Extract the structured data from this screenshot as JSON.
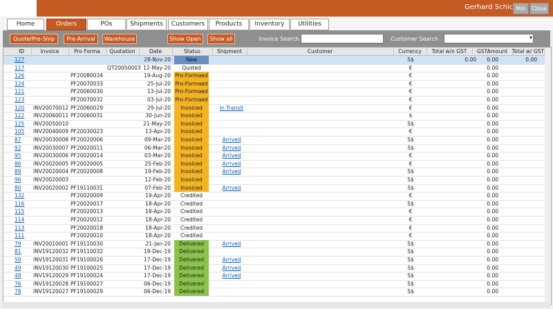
{
  "header": {
    "user_name": "Gerhard Schick",
    "min_label": "Min",
    "close_label": "Close"
  },
  "tabs": [
    "Home",
    "Orders",
    "POs",
    "Shipments",
    "Customers",
    "Products",
    "Inventory",
    "Utilities"
  ],
  "active_tab": "Orders",
  "filters": {
    "buttons": [
      "Quote/Pre-Ship",
      "Pre-Arrival",
      "Warehouse"
    ],
    "show_open": "Show Open",
    "show_all": "Show all",
    "invoice_search_label": "Invoice Search",
    "customer_search_label": "Customer Search"
  },
  "columns": [
    "ID",
    "Invoice",
    "Pro Forma",
    "Quotation",
    "Date",
    "Status",
    "Shipment",
    "Customer",
    "Currency",
    "Total w/o GST",
    "GSTAmount",
    "Total w/ GST"
  ],
  "rows": [
    {
      "id": "127",
      "inv": "",
      "pf": "",
      "q": "",
      "date": "28-Nov-20",
      "status": "New",
      "ship": "",
      "cur": "S$",
      "tot": "0.00",
      "gst": "0.00",
      "tgst": "0.00"
    },
    {
      "id": "117",
      "inv": "",
      "pf": "",
      "q": "QT20050003",
      "date": "12-May-20",
      "status": "Quoted",
      "ship": "",
      "cur": "€",
      "tot": "",
      "gst": "0.00",
      "tgst": ""
    },
    {
      "id": "126",
      "inv": "",
      "pf": "PF20080034",
      "q": "",
      "date": "19-Aug-20",
      "status": "Pro-Formaed",
      "ship": "",
      "cur": "€",
      "tot": "",
      "gst": "0.00",
      "tgst": ""
    },
    {
      "id": "124",
      "inv": "",
      "pf": "PF20070033",
      "q": "",
      "date": "25-Jul-20",
      "status": "Pro-Formaed",
      "ship": "",
      "cur": "€",
      "tot": "",
      "gst": "0.00",
      "tgst": ""
    },
    {
      "id": "121",
      "inv": "",
      "pf": "PF20060030",
      "q": "",
      "date": "13-Jul-20",
      "status": "Pro-Formaed",
      "ship": "",
      "cur": "€",
      "tot": "",
      "gst": "0.00",
      "tgst": ""
    },
    {
      "id": "123",
      "inv": "",
      "pf": "PF20070032",
      "q": "",
      "date": "03-Jul-20",
      "status": "Pro-Formaed",
      "ship": "",
      "cur": "€",
      "tot": "",
      "gst": "0.00",
      "tgst": ""
    },
    {
      "id": "120",
      "inv": "INV20070012",
      "pf": "PF20060029",
      "q": "",
      "date": "29-Jul-20",
      "status": "Invoiced",
      "ship": "In Transit",
      "cur": "€",
      "tot": "",
      "gst": "0.00",
      "tgst": ""
    },
    {
      "id": "122",
      "inv": "INV20060011",
      "pf": "PF20060031",
      "q": "",
      "date": "30-Jun-20",
      "status": "Invoiced",
      "ship": "",
      "cur": "$",
      "tot": "",
      "gst": "0.00",
      "tgst": ""
    },
    {
      "id": "125",
      "inv": "INV20050010",
      "pf": "",
      "q": "",
      "date": "21-May-20",
      "status": "Invoiced",
      "ship": "",
      "cur": "S$",
      "tot": "",
      "gst": "0.00",
      "tgst": ""
    },
    {
      "id": "105",
      "inv": "INV20040009",
      "pf": "PF20030023",
      "q": "",
      "date": "13-Apr-20",
      "status": "Invoiced",
      "ship": "",
      "cur": "€",
      "tot": "",
      "gst": "0.00",
      "tgst": ""
    },
    {
      "id": "87",
      "inv": "INV20030008",
      "pf": "PF20020006",
      "q": "",
      "date": "09-Mar-20",
      "status": "Invoiced",
      "ship": "Arrived",
      "cur": "S$",
      "tot": "",
      "gst": "0.00",
      "tgst": ""
    },
    {
      "id": "92",
      "inv": "INV20030007",
      "pf": "PF20020011",
      "q": "",
      "date": "06-Mar-20",
      "status": "Invoiced",
      "ship": "Arrived",
      "cur": "S$",
      "tot": "",
      "gst": "0.00",
      "tgst": ""
    },
    {
      "id": "95",
      "inv": "INV20030006",
      "pf": "PF20020014",
      "q": "",
      "date": "03-Mar-20",
      "status": "Invoiced",
      "ship": "Arrived",
      "cur": "€",
      "tot": "",
      "gst": "0.00",
      "tgst": ""
    },
    {
      "id": "86",
      "inv": "INV20020005",
      "pf": "PF20020005",
      "q": "",
      "date": "25-Feb-20",
      "status": "Invoiced",
      "ship": "Arrived",
      "cur": "€",
      "tot": "",
      "gst": "0.00",
      "tgst": ""
    },
    {
      "id": "89",
      "inv": "INV20020004",
      "pf": "PF20020008",
      "q": "",
      "date": "19-Feb-20",
      "status": "Invoiced",
      "ship": "Arrived",
      "cur": "S$",
      "tot": "",
      "gst": "0.00",
      "tgst": ""
    },
    {
      "id": "96",
      "inv": "INV20020003",
      "pf": "",
      "q": "",
      "date": "12-Feb-20",
      "status": "Invoiced",
      "ship": "",
      "cur": "S$",
      "tot": "",
      "gst": "0.00",
      "tgst": ""
    },
    {
      "id": "80",
      "inv": "INV20020002",
      "pf": "PF19110031",
      "q": "",
      "date": "07-Feb-20",
      "status": "Invoiced",
      "ship": "Arrived",
      "cur": "S$",
      "tot": "",
      "gst": "0.00",
      "tgst": ""
    },
    {
      "id": "132",
      "inv": "",
      "pf": "PF20020009",
      "q": "",
      "date": "19-Apr-20",
      "status": "Credited",
      "ship": "",
      "cur": "€",
      "tot": "",
      "gst": "0.00",
      "tgst": ""
    },
    {
      "id": "116",
      "inv": "",
      "pf": "PF20020017",
      "q": "",
      "date": "18-Apr-20",
      "status": "Credited",
      "ship": "",
      "cur": "S$",
      "tot": "",
      "gst": "0.00",
      "tgst": ""
    },
    {
      "id": "115",
      "inv": "",
      "pf": "PF20020013",
      "q": "",
      "date": "18-Apr-20",
      "status": "Credited",
      "ship": "",
      "cur": "€",
      "tot": "",
      "gst": "0.00",
      "tgst": ""
    },
    {
      "id": "114",
      "inv": "",
      "pf": "PF20020012",
      "q": "",
      "date": "18-Apr-20",
      "status": "Credited",
      "ship": "",
      "cur": "€",
      "tot": "",
      "gst": "0.00",
      "tgst": ""
    },
    {
      "id": "113",
      "inv": "",
      "pf": "PF20020018",
      "q": "",
      "date": "18-Apr-20",
      "status": "Credited",
      "ship": "",
      "cur": "€",
      "tot": "",
      "gst": "0.00",
      "tgst": ""
    },
    {
      "id": "111",
      "inv": "",
      "pf": "PF20020010",
      "q": "",
      "date": "18-Apr-20",
      "status": "Credited",
      "ship": "",
      "cur": "€",
      "tot": "",
      "gst": "0.00",
      "tgst": ""
    },
    {
      "id": "79",
      "inv": "INV20010001",
      "pf": "PF19110030",
      "q": "",
      "date": "21-Jan-20",
      "status": "Delivered",
      "ship": "Arrived",
      "cur": "S$",
      "tot": "",
      "gst": "0.00",
      "tgst": ""
    },
    {
      "id": "81",
      "inv": "INV19120032",
      "pf": "PF19110032",
      "q": "",
      "date": "18-Dec-19",
      "status": "Delivered",
      "ship": "",
      "cur": "S$",
      "tot": "",
      "gst": "0.00",
      "tgst": ""
    },
    {
      "id": "50",
      "inv": "INV19120031",
      "pf": "PF19100026",
      "q": "",
      "date": "17-Dec-19",
      "status": "Delivered",
      "ship": "Arrived",
      "cur": "S$",
      "tot": "",
      "gst": "0.00",
      "tgst": ""
    },
    {
      "id": "49",
      "inv": "INV19120030",
      "pf": "PF19100025",
      "q": "",
      "date": "17-Dec-19",
      "status": "Delivered",
      "ship": "Arrived",
      "cur": "S$",
      "tot": "",
      "gst": "0.00",
      "tgst": ""
    },
    {
      "id": "48",
      "inv": "INV19120029",
      "pf": "PF19100024",
      "q": "",
      "date": "17-Dec-19",
      "status": "Delivered",
      "ship": "Arrived",
      "cur": "S$",
      "tot": "",
      "gst": "0.00",
      "tgst": ""
    },
    {
      "id": "76",
      "inv": "INV19120028",
      "pf": "PF19100027",
      "q": "",
      "date": "06-Dec-19",
      "status": "Delivered",
      "ship": "",
      "cur": "S$",
      "tot": "",
      "gst": "0.00",
      "tgst": ""
    },
    {
      "id": "78",
      "inv": "INV19120027",
      "pf": "PF19100029",
      "q": "",
      "date": "06-Dec-19",
      "status": "Delivered",
      "ship": "",
      "cur": "S$",
      "tot": "",
      "gst": "0.00",
      "tgst": ""
    }
  ]
}
